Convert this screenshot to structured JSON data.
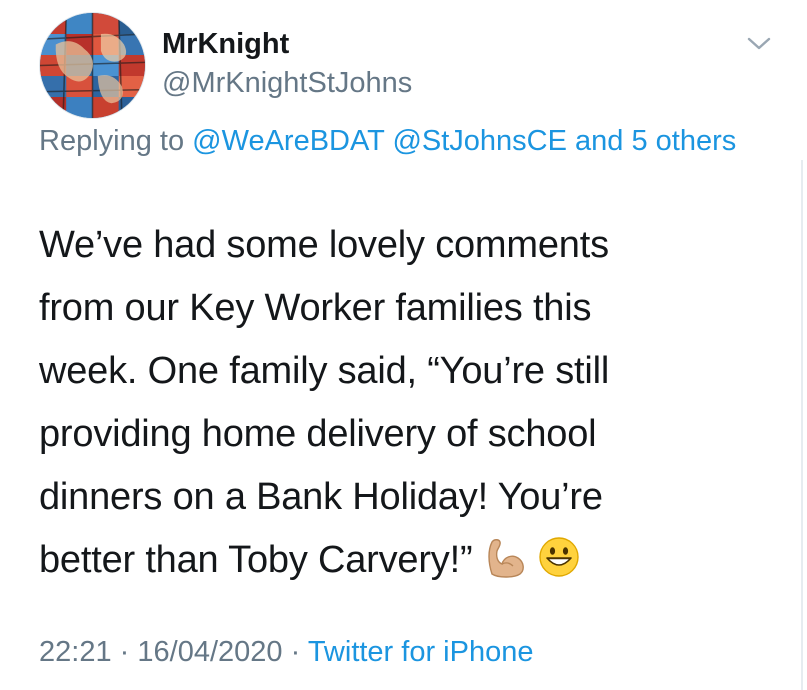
{
  "author": {
    "display_name": "MrKnight",
    "handle": "@MrKnightStJohns"
  },
  "reply": {
    "prefix": "Replying to",
    "mentions": [
      "@WeAreBDAT",
      "@StJohnsCE"
    ],
    "joiner": "and",
    "others_count": "5",
    "others_word": "others"
  },
  "tweet": {
    "lines": [
      "We’ve had some lovely comments",
      "from our Key Worker families this",
      "week. One family said, “You’re still",
      "providing home delivery of school",
      "dinners on a Bank Holiday! You’re",
      "better than Toby Carvery!”"
    ],
    "emojis": [
      "flexed-biceps-emoji",
      "grinning-face-emoji"
    ]
  },
  "meta": {
    "time": "22:21",
    "separator": "·",
    "date": "16/04/2020",
    "source": "Twitter for iPhone"
  },
  "icons": {
    "menu": "chevron-down-icon"
  },
  "colors": {
    "link": "#1b95e0",
    "secondary_text": "#657786",
    "primary_text": "#14171a"
  }
}
